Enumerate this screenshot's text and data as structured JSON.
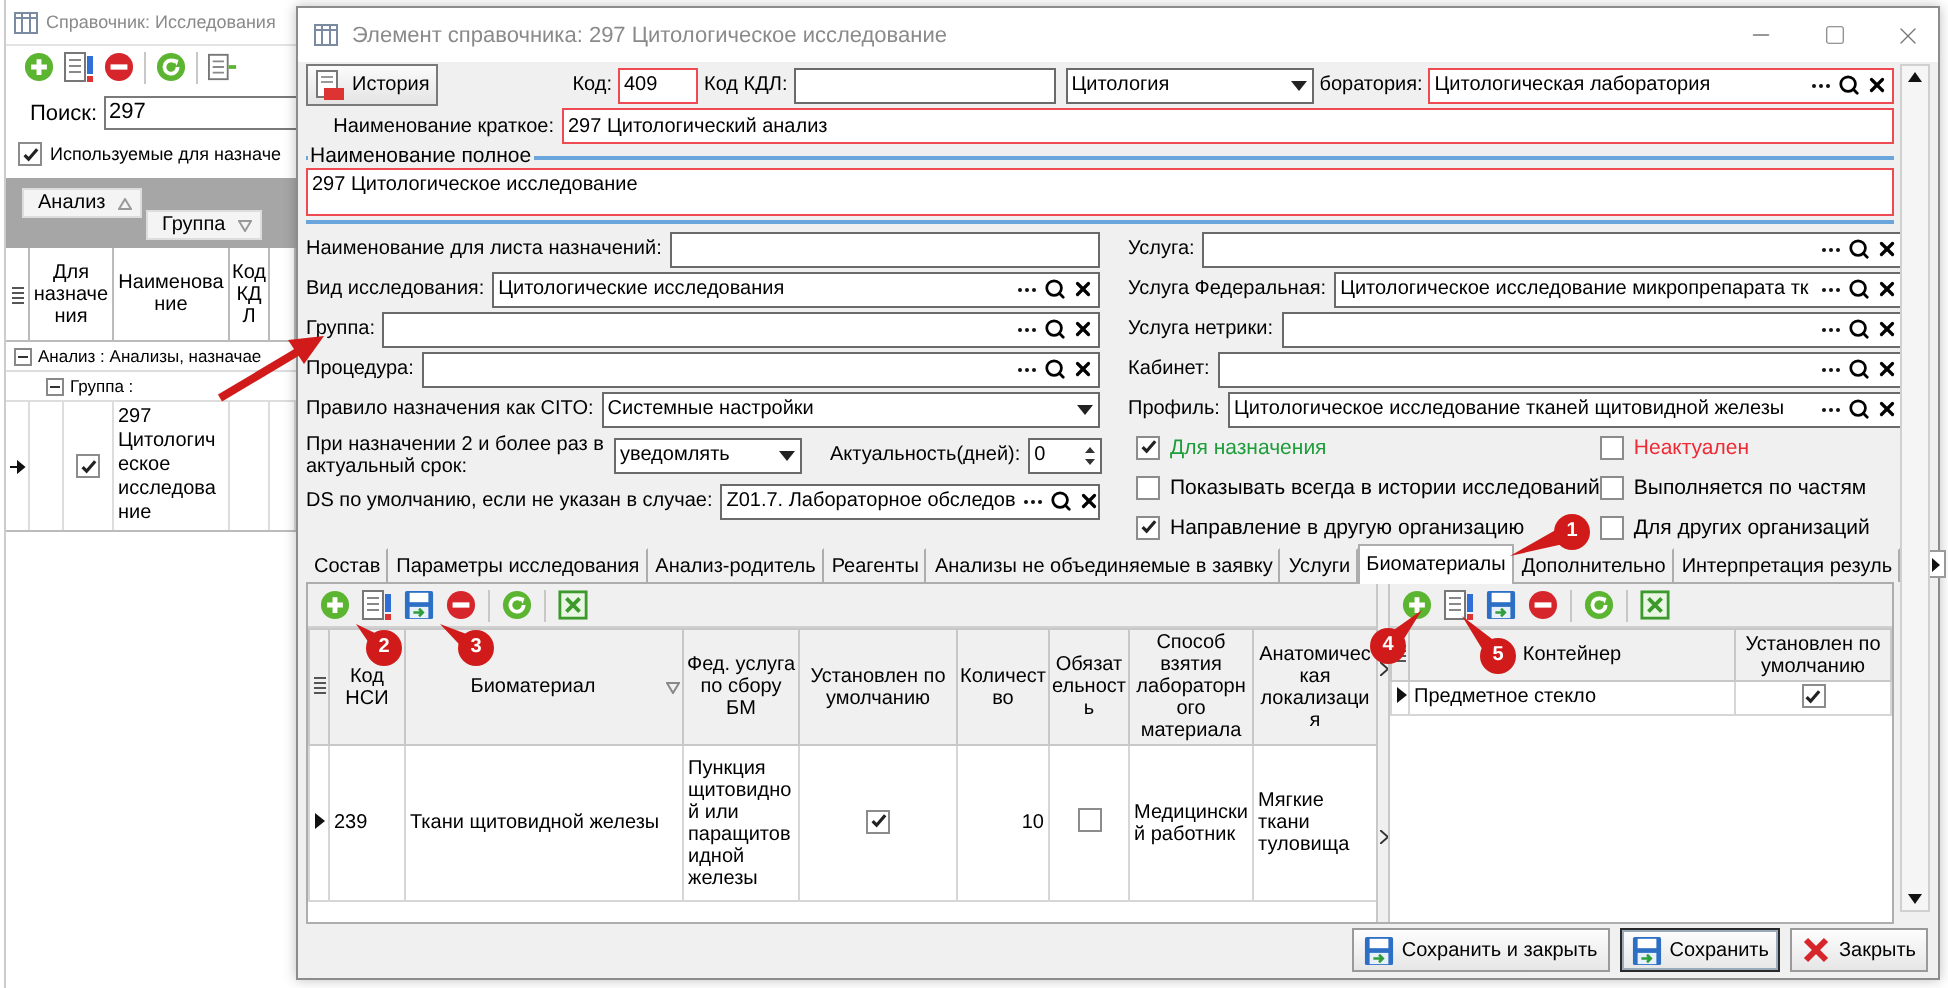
{
  "background_window": {
    "title": "Справочник: Исследования",
    "search": {
      "label": "Поиск:",
      "value": "297"
    },
    "filter_checkbox": {
      "label": "Используемые для назначе",
      "checked": true
    },
    "group_by": [
      "Анализ",
      "Группа"
    ],
    "columns": [
      "Для назначения",
      "Наименование",
      "Код КДЛ"
    ],
    "group_row": "Анализ : Анализы, назначае",
    "subgroup_row": "Группа :",
    "rows": [
      {
        "for_assignment": true,
        "name": "297 Цитологическое исследование",
        "selected": true
      }
    ]
  },
  "dialog": {
    "title": "Элемент справочника: 297 Цитологическое исследование",
    "history_button": "История",
    "code": {
      "label": "Код:",
      "value": "409",
      "required": true
    },
    "kdl_code": {
      "label": "Код КДЛ:",
      "required": false
    },
    "department": {
      "value": "Цитология"
    },
    "laboratory": {
      "label": "боратория:",
      "value": "Цитологическая лаборатория",
      "required": true
    },
    "short_name": {
      "label": "Наименование краткое:",
      "value": "297 Цитологический анализ",
      "required": true
    },
    "full_name": {
      "label": "Наименование полное",
      "value": "297 Цитологическое исследование",
      "required": true
    },
    "left_fields": [
      {
        "kind": "text",
        "label": "Наименование для листа назначений:"
      },
      {
        "kind": "lookup",
        "label": "Вид исследования:",
        "value": "Цитологические исследования"
      },
      {
        "kind": "lookup",
        "label": "Группа:"
      },
      {
        "kind": "lookup",
        "label": "Процедура:"
      },
      {
        "kind": "select",
        "label": "Правило назначения как CITO:",
        "value": "Системные настройки"
      },
      {
        "kind": "select_spin",
        "label": "При назначении 2 и более раз в актуальный срок:",
        "value": "уведомлять",
        "spin_label": "Актуальность(дней):",
        "spin_value": "0"
      },
      {
        "kind": "lookup",
        "label": "DS по умолчанию, если не указан в случае:",
        "value": "Z01.7. Лабораторное обследов"
      }
    ],
    "right_fields": [
      {
        "kind": "lookup",
        "label": "Услуга:"
      },
      {
        "kind": "lookup",
        "label": "Услуга Федеральная:",
        "value": "Цитологическое исследование микропрепарата тк"
      },
      {
        "kind": "lookup",
        "label": "Услуга нетрики:"
      },
      {
        "kind": "lookup",
        "label": "Кабинет:"
      },
      {
        "kind": "lookup",
        "label": "Профиль:",
        "value": "Цитологическое исследование тканей щитовидной железы"
      }
    ],
    "flags": [
      {
        "label": "Для назначения",
        "checked": true,
        "color": "#1e9e3a"
      },
      {
        "label": "Неактуален",
        "checked": false,
        "color": "#ee2a34"
      },
      {
        "label": "Показывать всегда в истории исследований",
        "checked": false,
        "color": "#000000"
      },
      {
        "label": "Выполняется по частям",
        "checked": false,
        "color": "#000000"
      },
      {
        "label": "Направление в другую организацию",
        "checked": true,
        "color": "#000000"
      },
      {
        "label": "Для других организаций",
        "checked": false,
        "color": "#000000"
      }
    ],
    "tabs": [
      {
        "label": "Состав",
        "selected": false
      },
      {
        "label": "Параметры исследования",
        "selected": false
      },
      {
        "label": "Анализ-родитель",
        "selected": false
      },
      {
        "label": "Реагенты",
        "selected": false
      },
      {
        "label": "Анализы не объединяемые в заявку",
        "selected": false
      },
      {
        "label": "Услуги",
        "selected": false
      },
      {
        "label": "Биоматериалы",
        "selected": true
      },
      {
        "label": "Дополнительно",
        "selected": false
      },
      {
        "label": "Интерпретация резуль",
        "selected": false
      }
    ],
    "biomaterials": {
      "columns": [
        {
          "label": "Код НСИ",
          "filter_button": false
        },
        {
          "label": "Биоматериал",
          "filter_button": true
        },
        {
          "label": "Фед. услуга по сбору БМ",
          "filter_button": false
        },
        {
          "label": "Установлен по умолчанию",
          "filter_button": false
        },
        {
          "label": "Количество",
          "filter_button": false
        },
        {
          "label": "Обязательность",
          "filter_button": false
        },
        {
          "label": "Способ взятия лабораторного материала",
          "filter_button": false
        },
        {
          "label": "Анатомическая локализация",
          "filter_button": false
        }
      ],
      "rows": [
        {
          "selected": true,
          "code": "239",
          "name": "Ткани щитовидной железы",
          "fed_service": "Пункция щитовидной или паращитовидной железы",
          "default": true,
          "quantity": "10",
          "mandatory": false,
          "method": "Медицинский работник",
          "location": "Мягкие ткани туловища"
        }
      ]
    },
    "containers": {
      "columns": [
        "Контейнер",
        "Установлен по умолчанию"
      ],
      "rows": [
        {
          "selected": true,
          "name": "Предметное стекло",
          "default": true
        }
      ]
    },
    "buttons": [
      {
        "kind": "save_close",
        "label": "Сохранить и закрыть",
        "focused": false
      },
      {
        "kind": "save",
        "label": "Сохранить",
        "focused": true
      },
      {
        "kind": "close",
        "label": "Закрыть",
        "focused": false
      }
    ]
  },
  "callouts": [
    {
      "number": "1"
    },
    {
      "number": "2"
    },
    {
      "number": "3"
    },
    {
      "number": "4"
    },
    {
      "number": "5"
    }
  ]
}
